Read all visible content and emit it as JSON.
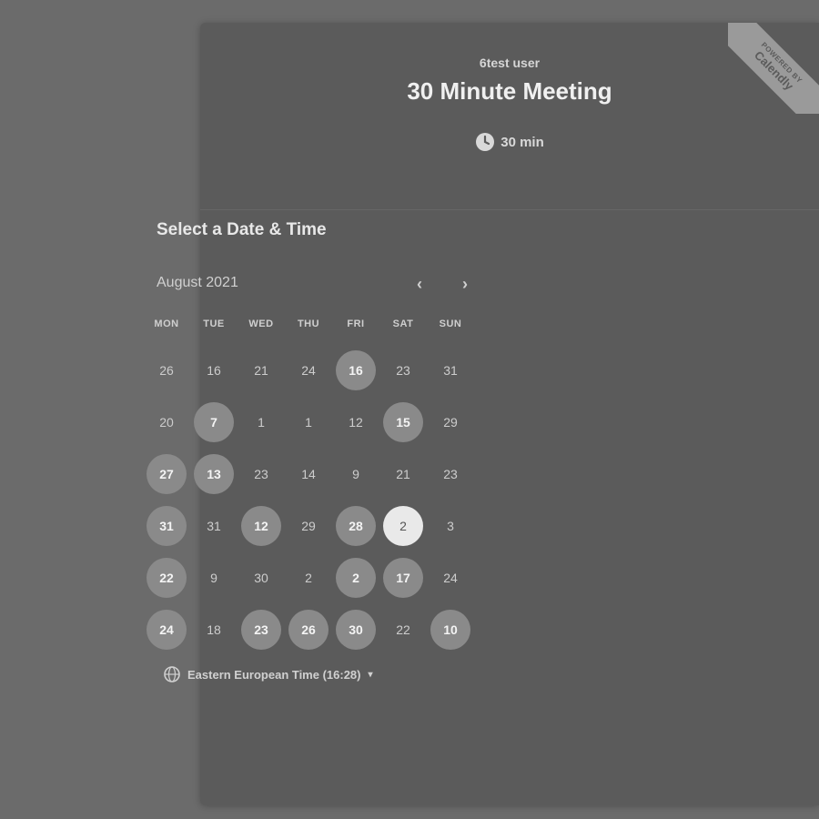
{
  "event": {
    "host": "6test user",
    "title": "30 Minute Meeting",
    "duration": "30 min",
    "icon": "clock-icon"
  },
  "badge": {
    "powered_by": "POWERED BY",
    "brand": "Calendly"
  },
  "calendar": {
    "heading": "Select a Date & Time",
    "month": "August 2021",
    "prev_icon": "chevron-left-icon",
    "next_icon": "chevron-right-icon",
    "prev_glyph": "‹",
    "next_glyph": "›",
    "weekdays": [
      "MON",
      "TUE",
      "WED",
      "THU",
      "FRI",
      "SAT",
      "SUN"
    ],
    "weeks": [
      [
        {
          "n": "26",
          "s": "none"
        },
        {
          "n": "16",
          "s": "none"
        },
        {
          "n": "21",
          "s": "none"
        },
        {
          "n": "24",
          "s": "none"
        },
        {
          "n": "16",
          "s": "available"
        },
        {
          "n": "23",
          "s": "none"
        },
        {
          "n": "31",
          "s": "none"
        }
      ],
      [
        {
          "n": "20",
          "s": "none"
        },
        {
          "n": "7",
          "s": "available"
        },
        {
          "n": "1",
          "s": "none"
        },
        {
          "n": "1",
          "s": "none"
        },
        {
          "n": "12",
          "s": "none"
        },
        {
          "n": "15",
          "s": "available"
        },
        {
          "n": "29",
          "s": "none"
        }
      ],
      [
        {
          "n": "27",
          "s": "available"
        },
        {
          "n": "13",
          "s": "available"
        },
        {
          "n": "23",
          "s": "none"
        },
        {
          "n": "14",
          "s": "none"
        },
        {
          "n": "9",
          "s": "none"
        },
        {
          "n": "21",
          "s": "none"
        },
        {
          "n": "23",
          "s": "none"
        }
      ],
      [
        {
          "n": "31",
          "s": "available"
        },
        {
          "n": "31",
          "s": "none"
        },
        {
          "n": "12",
          "s": "available"
        },
        {
          "n": "29",
          "s": "none"
        },
        {
          "n": "28",
          "s": "available"
        },
        {
          "n": "2",
          "s": "selected"
        },
        {
          "n": "3",
          "s": "none"
        }
      ],
      [
        {
          "n": "22",
          "s": "available"
        },
        {
          "n": "9",
          "s": "none"
        },
        {
          "n": "30",
          "s": "none"
        },
        {
          "n": "2",
          "s": "none"
        },
        {
          "n": "2",
          "s": "available"
        },
        {
          "n": "17",
          "s": "available"
        },
        {
          "n": "24",
          "s": "none"
        }
      ],
      [
        {
          "n": "24",
          "s": "available"
        },
        {
          "n": "18",
          "s": "none"
        },
        {
          "n": "23",
          "s": "available"
        },
        {
          "n": "26",
          "s": "available"
        },
        {
          "n": "30",
          "s": "available"
        },
        {
          "n": "22",
          "s": "none"
        },
        {
          "n": "10",
          "s": "available"
        }
      ]
    ]
  },
  "timezone": {
    "label": "Eastern European Time (16:28)",
    "icon": "globe-icon",
    "caret_icon": "caret-down-icon",
    "caret": "▾"
  }
}
